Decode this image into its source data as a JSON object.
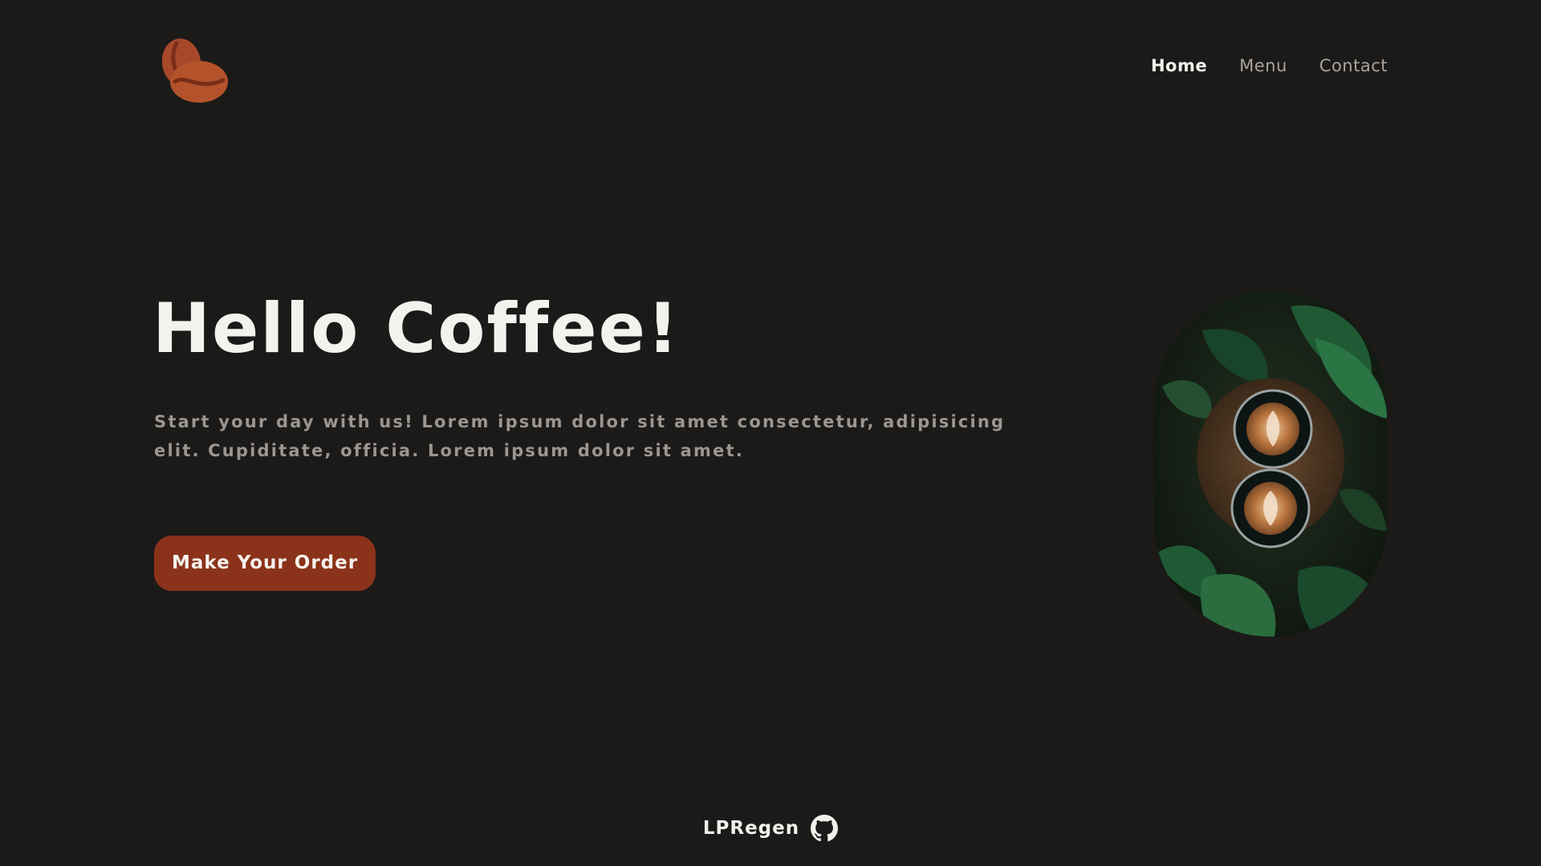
{
  "header": {
    "logo_icon": "coffee-beans-icon",
    "nav": [
      {
        "label": "Home",
        "active": true
      },
      {
        "label": "Menu",
        "active": false
      },
      {
        "label": "Contact",
        "active": false
      }
    ]
  },
  "hero": {
    "title": "Hello Coffee!",
    "description": "Start your day with us! Lorem ipsum dolor sit amet consectetur, adipisicing elit. Cupiditate, officia. Lorem ipsum dolor sit amet.",
    "cta_label": "Make Your Order",
    "image_subject": "two latte art cups on wooden table with green leaves"
  },
  "footer": {
    "author": "LPRegen",
    "icon": "github-icon"
  },
  "colors": {
    "background": "#1c1a19",
    "accent": "#8b321a",
    "logo": "#b4532b",
    "text_primary": "#f4f2ee",
    "text_muted": "#9a9692"
  }
}
